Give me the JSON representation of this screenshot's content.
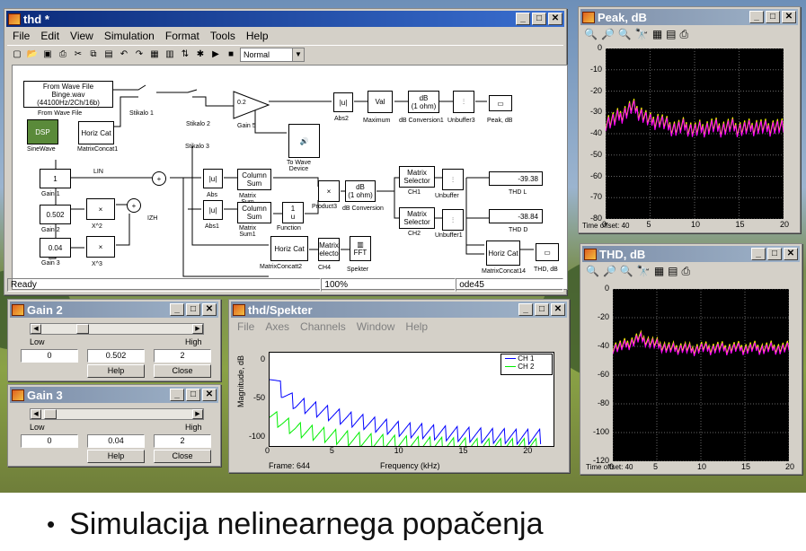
{
  "main_window": {
    "title": "thd *",
    "menu": [
      "File",
      "Edit",
      "View",
      "Simulation",
      "Format",
      "Tools",
      "Help"
    ],
    "zoom_select": "Normal",
    "status": {
      "left": "Ready",
      "zoom": "100%",
      "solver": "ode45"
    }
  },
  "model": {
    "wave_file": "From Wave File\nBinge.wav\n(44100Hz/2Ch/16b)",
    "wave_file_label": "From Wave File",
    "dsp": "DSP",
    "sine_label": "SineWave",
    "hcat1": "Horiz Cat",
    "hcat1_label": "MatrixConcat1",
    "stikalo1": "Stikalo 1",
    "stikalo2": "Stikalo 2",
    "stikalo3": "Stikalo 3",
    "gain5_val": "0.2",
    "gain5_label": "Gain 5",
    "abs2": "|u|",
    "abs2_label": "Abs2",
    "maximum": "Val",
    "maximum_label": "Maximum",
    "db1": "dB\n(1 ohm)",
    "db1_label": "dB Conversion1",
    "unbuffer3_label": "Unbuffer3",
    "peak_label": "Peak, dB",
    "to_wave_label": "To Wave\nDevice",
    "gain1_val": "1",
    "gain1_label": "Gain 1",
    "lin": "LIN",
    "gain2_val": "0.502",
    "gain2_label": "Gain 2",
    "x2": "×",
    "x2_label": "X^2",
    "gain3_val": "0.04",
    "gain3_label": "Gain 3",
    "x3_label": "X^3",
    "izh": "IZH",
    "abs": "|u|",
    "abs_label": "Abs",
    "abs1_label": "Abs1",
    "colsum": "Column\nSum",
    "matrix_sum": "Matrix\nSum",
    "matrix_sum1": "Matrix\nSum1",
    "function_label": "Function",
    "product3_label": "Product3",
    "db2": "dB\n(1 ohm)",
    "db2_label": "dB Conversion",
    "msel": "Matrix\nSelector",
    "ch1": "CH1",
    "ch2": "CH2",
    "unbuffer": "Unbuffer",
    "unbuffer1": "Unbuffer1",
    "thdl_val": "-39.38",
    "thdl_label": "THD L",
    "thdd_val": "-38.84",
    "thdd_label": "THD D",
    "hcat14_label": "MatrixConcat14",
    "thd_db_label": "THD, dB",
    "hcat2": "Horiz Cat",
    "hcat2_label": "MatrixConcatt2",
    "matrix_electo": "Matrix\nelecto",
    "ch4": "CH4",
    "fft": "FFT",
    "spekter_label": "Spekter"
  },
  "peak_window": {
    "title": "Peak, dB",
    "yticks": [
      "0",
      "-10",
      "-20",
      "-30",
      "-40",
      "-50",
      "-60",
      "-70",
      "-80"
    ],
    "xticks": [
      "0",
      "5",
      "10",
      "15",
      "20"
    ],
    "time_offset": "Time offset:  40"
  },
  "thd_window": {
    "title": "THD, dB",
    "yticks": [
      "0",
      "-20",
      "-40",
      "-60",
      "-80",
      "-100",
      "-120"
    ],
    "xticks": [
      "0",
      "5",
      "10",
      "15",
      "20"
    ],
    "time_offset": "Time offset:  40"
  },
  "gain2_window": {
    "title": "Gain 2",
    "low": "Low",
    "high": "High",
    "low_val": "0",
    "value": "0.502",
    "high_val": "2",
    "help": "Help",
    "close": "Close",
    "fraction": 0.251
  },
  "gain3_window": {
    "title": "Gain 3",
    "low": "Low",
    "high": "High",
    "low_val": "0",
    "value": "0.04",
    "high_val": "2",
    "help": "Help",
    "close": "Close",
    "fraction": 0.02
  },
  "spekter_window": {
    "title": "thd/Spekter",
    "menu": [
      "File",
      "Axes",
      "Channels",
      "Window",
      "Help"
    ],
    "ylabel": "Magnitude, dB",
    "xlabel": "Frequency (kHz)",
    "frame": "Frame: 644",
    "yticks": [
      "0",
      "-50",
      "-100"
    ],
    "xticks": [
      "0",
      "5",
      "10",
      "15",
      "20"
    ],
    "legend": [
      "CH 1",
      "CH 2"
    ]
  },
  "colors": {
    "ch1": "#0000ff",
    "ch2": "#00ee00",
    "magenta": "#ff00ff",
    "yellow": "#ffff00"
  },
  "caption": {
    "bullet": "•",
    "text": "Simulacija nelinearnega popačenja"
  },
  "chart_data": [
    {
      "type": "line",
      "title": "Peak, dB",
      "xlim": [
        0,
        20
      ],
      "ylim": [
        -80,
        0
      ],
      "series": [
        {
          "values": [
            -34,
            -33,
            -30,
            -27,
            -30,
            -34,
            -33,
            -36,
            -37,
            -36,
            -38,
            -37,
            -36,
            -37,
            -36,
            -37,
            -37,
            -36,
            -37,
            -36,
            -37
          ]
        }
      ]
    },
    {
      "type": "line",
      "title": "THD, dB",
      "xlim": [
        0,
        20
      ],
      "ylim": [
        -120,
        0
      ],
      "series": [
        {
          "values": [
            -40,
            -39,
            -37,
            -33,
            -36,
            -38,
            -40,
            -41,
            -40,
            -42,
            -40,
            -41,
            -40,
            -41,
            -40,
            -41,
            -40,
            -41,
            -40,
            -41,
            -40
          ]
        }
      ]
    },
    {
      "type": "line",
      "xlabel": "Frequency (kHz)",
      "ylabel": "Magnitude, dB",
      "xlim": [
        0,
        22
      ],
      "ylim": [
        -110,
        10
      ],
      "series": [
        {
          "name": "CH 1",
          "values": [
            -15,
            -40,
            -55,
            -60,
            -65,
            -70,
            -75,
            -78,
            -82,
            -85,
            -88,
            -90,
            -91,
            -93,
            -94,
            -95,
            -96,
            -97,
            -97,
            -98,
            -98,
            -98
          ]
        },
        {
          "name": "CH 2",
          "values": [
            -70,
            -80,
            -88,
            -92,
            -95,
            -98,
            -100,
            -102,
            -104,
            -105,
            -106,
            -107,
            -108,
            -108,
            -109,
            -109,
            -110,
            -110,
            -110,
            -110,
            -110,
            -110
          ]
        }
      ]
    }
  ]
}
